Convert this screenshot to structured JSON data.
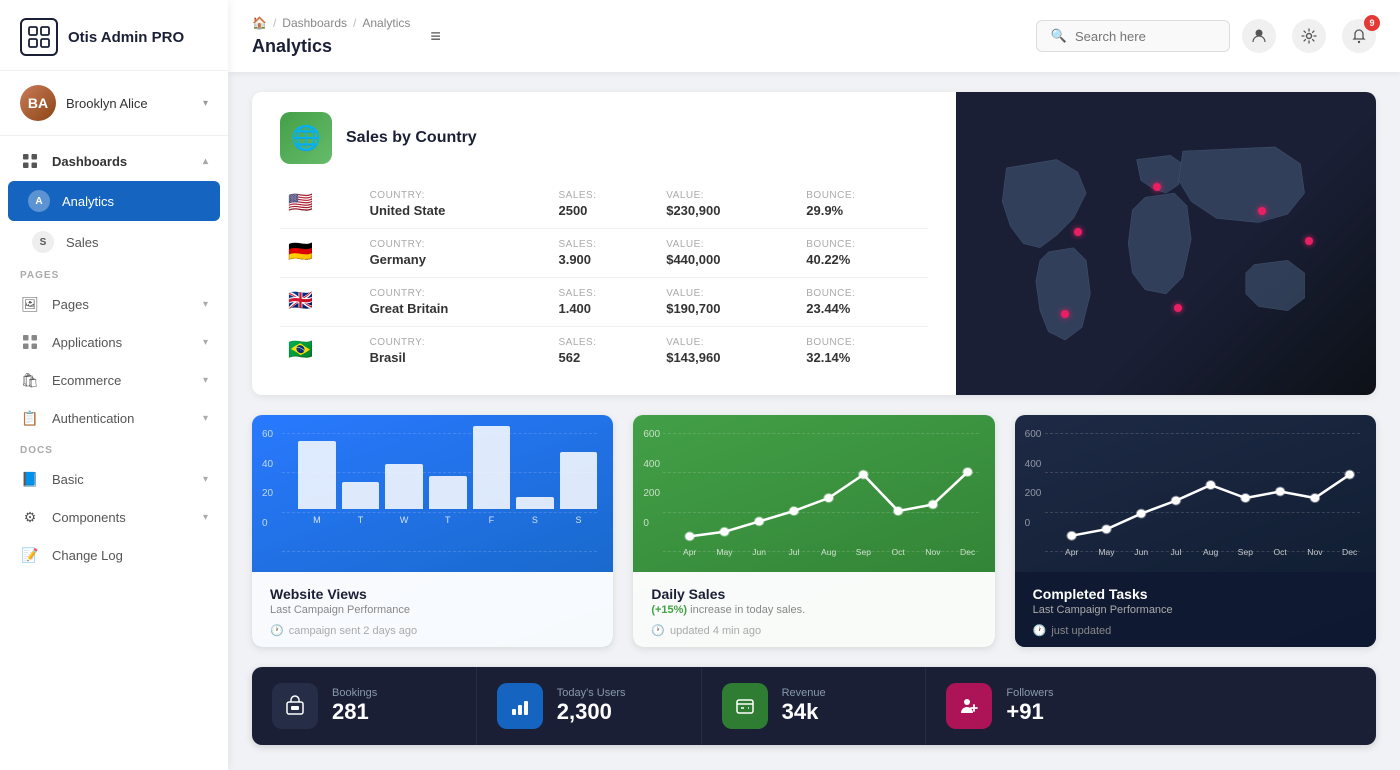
{
  "app": {
    "name": "Otis Admin PRO",
    "logo_symbol": "⊞"
  },
  "user": {
    "name": "Brooklyn Alice",
    "initials": "BA"
  },
  "sidebar": {
    "section_pages": "PAGES",
    "section_docs": "DOCS",
    "items": [
      {
        "id": "dashboards",
        "label": "Dashboards",
        "icon": "⊞",
        "active": false,
        "parent": true
      },
      {
        "id": "analytics",
        "label": "Analytics",
        "icon": "A",
        "active": true
      },
      {
        "id": "sales",
        "label": "Sales",
        "icon": "S",
        "active": false
      },
      {
        "id": "pages",
        "label": "Pages",
        "icon": "🖼",
        "active": false
      },
      {
        "id": "applications",
        "label": "Applications",
        "icon": "⊞",
        "active": false
      },
      {
        "id": "ecommerce",
        "label": "Ecommerce",
        "icon": "🛍",
        "active": false
      },
      {
        "id": "authentication",
        "label": "Authentication",
        "icon": "📋",
        "active": false
      },
      {
        "id": "basic",
        "label": "Basic",
        "icon": "📘",
        "active": false
      },
      {
        "id": "components",
        "label": "Components",
        "icon": "⚙",
        "active": false
      },
      {
        "id": "changelog",
        "label": "Change Log",
        "icon": "📝",
        "active": false
      }
    ]
  },
  "header": {
    "home_icon": "🏠",
    "breadcrumb": [
      "Dashboards",
      "Analytics"
    ],
    "title": "Analytics",
    "menu_icon": "≡",
    "search_placeholder": "Search here",
    "notification_count": "9"
  },
  "sales_by_country": {
    "title": "Sales by Country",
    "icon": "🌐",
    "columns": {
      "country_label": "Country:",
      "sales_label": "Sales:",
      "value_label": "Value:",
      "bounce_label": "Bounce:"
    },
    "rows": [
      {
        "flag": "🇺🇸",
        "country": "United State",
        "sales": "2500",
        "value": "$230,900",
        "bounce": "29.9%"
      },
      {
        "flag": "🇩🇪",
        "country": "Germany",
        "sales": "3.900",
        "value": "$440,000",
        "bounce": "40.22%"
      },
      {
        "flag": "🇬🇧",
        "country": "Great Britain",
        "sales": "1.400",
        "value": "$190,700",
        "bounce": "23.44%"
      },
      {
        "flag": "🇧🇷",
        "country": "Brasil",
        "sales": "562",
        "value": "$143,960",
        "bounce": "32.14%"
      }
    ]
  },
  "website_views": {
    "title": "Website Views",
    "subtitle": "Last Campaign Performance",
    "meta": "campaign sent 2 days ago",
    "y_labels": [
      "60",
      "40",
      "20",
      "0"
    ],
    "x_labels": [
      "M",
      "T",
      "W",
      "T",
      "F",
      "S",
      "S"
    ],
    "bars": [
      45,
      18,
      30,
      22,
      55,
      8,
      38
    ]
  },
  "daily_sales": {
    "title": "Daily Sales",
    "subtitle_prefix": "(+15%)",
    "subtitle_text": " increase in today sales.",
    "meta": "updated 4 min ago",
    "y_labels": [
      "600",
      "400",
      "200",
      "0"
    ],
    "x_labels": [
      "Apr",
      "May",
      "Jun",
      "Jul",
      "Aug",
      "Sep",
      "Oct",
      "Nov",
      "Dec"
    ],
    "points": [
      5,
      40,
      120,
      200,
      300,
      480,
      200,
      250,
      500
    ]
  },
  "completed_tasks": {
    "title": "Completed Tasks",
    "subtitle": "Last Campaign Performance",
    "meta": "just updated",
    "y_labels": [
      "600",
      "400",
      "200",
      "0"
    ],
    "x_labels": [
      "Apr",
      "May",
      "Jun",
      "Jul",
      "Aug",
      "Sep",
      "Oct",
      "Nov",
      "Dec"
    ],
    "points": [
      10,
      60,
      180,
      280,
      400,
      300,
      350,
      300,
      480
    ]
  },
  "stats": [
    {
      "id": "bookings",
      "label": "Bookings",
      "value": "281",
      "icon": "🛋",
      "color": "dark"
    },
    {
      "id": "today_users",
      "label": "Today's Users",
      "value": "2,300",
      "icon": "📊",
      "color": "blue"
    },
    {
      "id": "revenue",
      "label": "Revenue",
      "value": "34k",
      "icon": "🗂",
      "color": "green"
    },
    {
      "id": "followers",
      "label": "Followers",
      "value": "+91",
      "icon": "👤",
      "color": "pink"
    }
  ]
}
